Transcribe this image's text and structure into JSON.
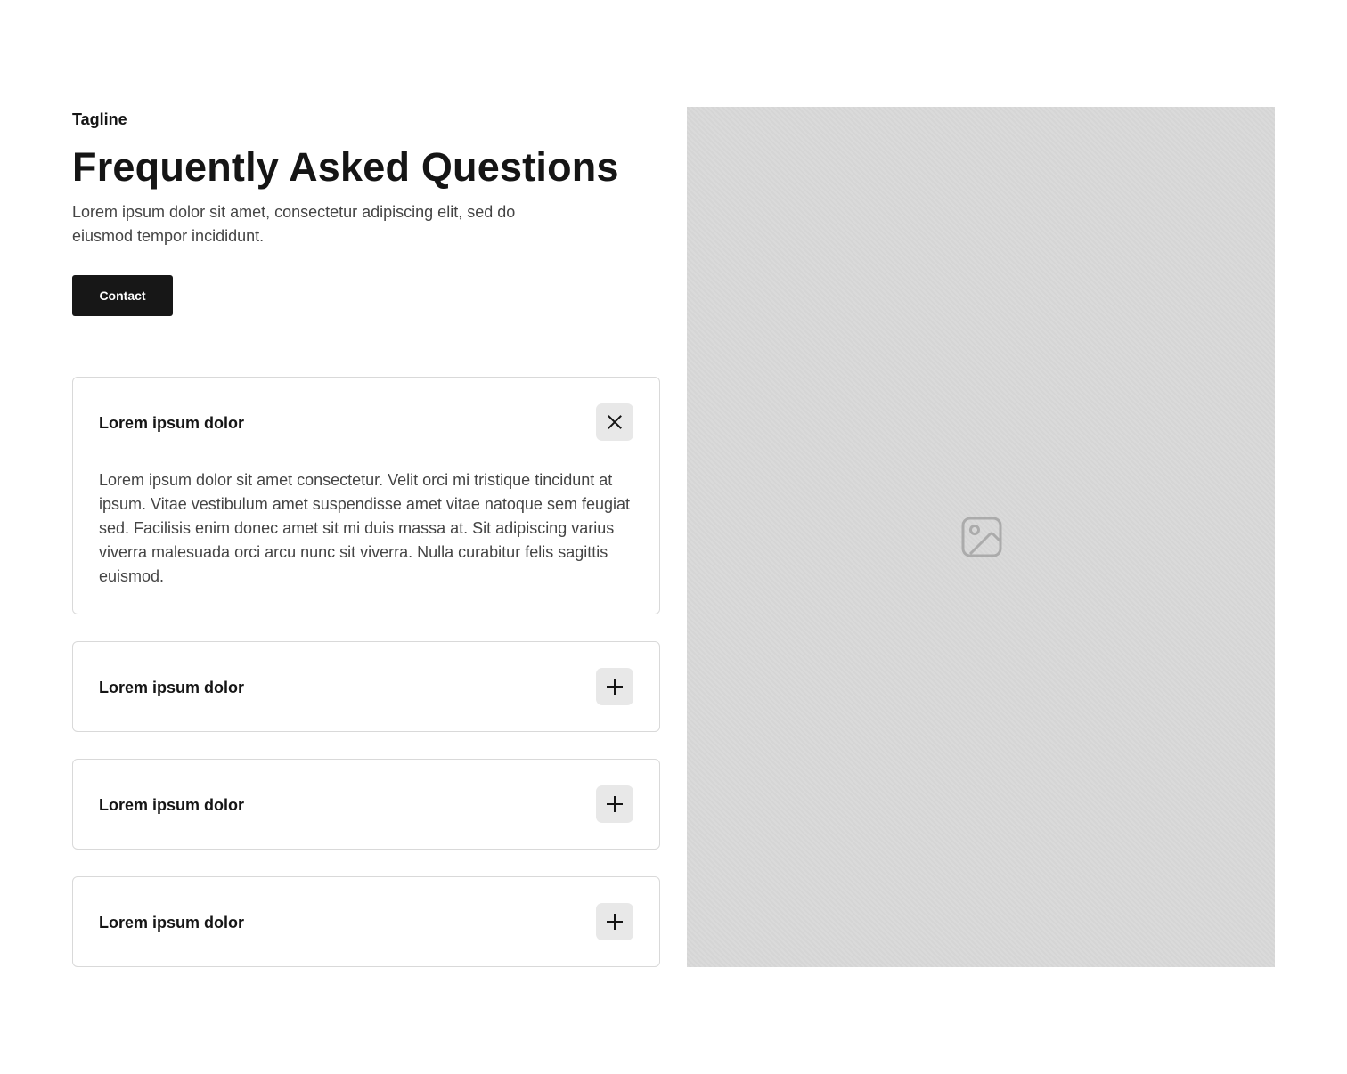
{
  "header": {
    "tagline": "Tagline",
    "title": "Frequently Asked Questions",
    "subtitle": "Lorem ipsum dolor sit amet, consectetur adipiscing elit, sed do eiusmod tempor incididunt.",
    "contact_label": "Contact"
  },
  "faq": {
    "items": [
      {
        "question": "Lorem ipsum dolor",
        "expanded": true,
        "answer": "Lorem ipsum dolor sit amet consectetur. Velit orci mi tristique tincidunt at ipsum. Vitae vestibulum amet suspendisse amet vitae natoque sem feugiat sed. Facilisis enim donec amet sit mi duis massa at. Sit adipiscing varius viverra malesuada orci arcu nunc sit viverra. Nulla curabitur felis sagittis euismod.",
        "toggle_icon": "close-icon"
      },
      {
        "question": "Lorem ipsum dolor",
        "expanded": false,
        "toggle_icon": "plus-icon"
      },
      {
        "question": "Lorem ipsum dolor",
        "expanded": false,
        "toggle_icon": "plus-icon"
      },
      {
        "question": "Lorem ipsum dolor",
        "expanded": false,
        "toggle_icon": "plus-icon"
      }
    ]
  },
  "media": {
    "icon": "image-icon"
  },
  "colors": {
    "button_bg": "#171717",
    "toggle_bg": "#e8e8e8",
    "placeholder_bg": "#d8d8d8",
    "border": "#d9d9d9"
  }
}
